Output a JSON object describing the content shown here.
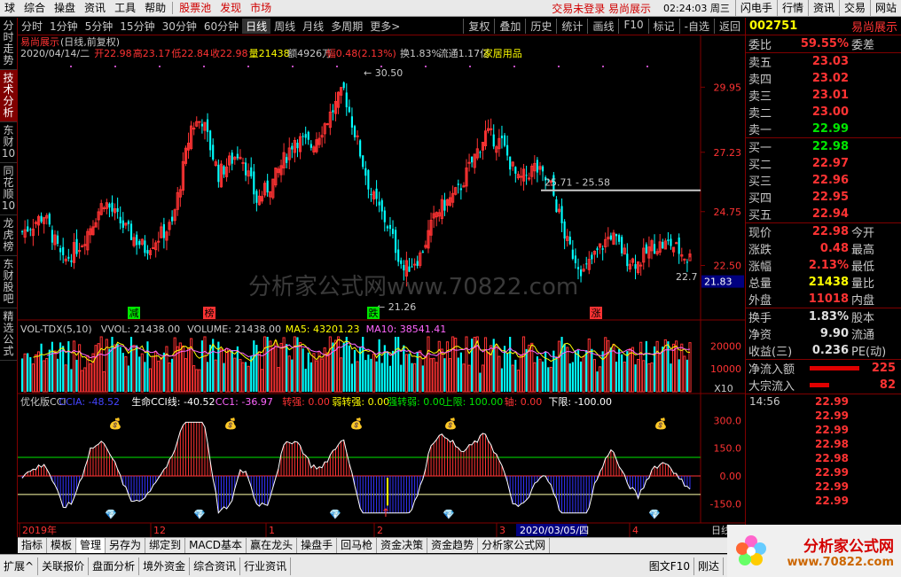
{
  "menu": {
    "items": [
      "球",
      "综合",
      "操盘",
      "资讯",
      "工具",
      "帮助"
    ],
    "red_items": [
      "股票池",
      "发现",
      "市场"
    ],
    "login": "交易未登录 易尚展示",
    "clock": "02:24:03 周三",
    "right": [
      "闪电手",
      "行情",
      "资讯",
      "交易",
      "网站"
    ]
  },
  "toolbar": {
    "periods": [
      "分时",
      "1分钟",
      "5分钟",
      "15分钟",
      "30分钟",
      "60分钟",
      "日线",
      "周线",
      "月线",
      "多周期",
      "更多>"
    ],
    "active": "日线",
    "right": [
      "复权",
      "叠加",
      "历史",
      "统计",
      "画线",
      "F10",
      "标记",
      "-自选",
      "返回"
    ]
  },
  "leftbar": [
    "分时走势",
    "技术分析",
    "东财10",
    "同花顺10",
    "龙虎榜",
    "东财股吧",
    "精选公式"
  ],
  "leftbar_active": "技术分析",
  "kline": {
    "title": "易尚展示",
    "mode": "(日线,前复权)",
    "date": "2020/04/14/二",
    "open_label": "开",
    "open": "22.98",
    "high_label": "高",
    "high": "23.17",
    "low_label": "低",
    "low": "22.84",
    "close_label": "收",
    "close": "22.98",
    "vol_label": "量",
    "vol": "21438",
    "amt_label": "额",
    "amt": "4926万",
    "chg_label": "幅",
    "chg": "0.48(2.13%)",
    "turn": "换1.83%",
    "float": "流通1.17亿",
    "industry": "家居用品",
    "y_ticks": [
      "29.95",
      "27.23",
      "24.75",
      "22.50"
    ],
    "cur_price": "21.83",
    "max_label": "30.50",
    "min_label": "21.26",
    "last_label": "22.7",
    "level": "25.71 - 25.58",
    "marks": [
      "减",
      "榜",
      "跌",
      "涨"
    ]
  },
  "vol": {
    "title": "VOL-TDX(5,10)",
    "vvol": "VVOL: 21438.00",
    "volume": "VOLUME: 21438.00",
    "ma5": "MA5: 43201.23",
    "ma10": "MA10: 38541.41",
    "y_ticks": [
      "20000",
      "10000"
    ],
    "unit": "X10"
  },
  "cci": {
    "title": "优化版CCI",
    "ccia": "CCIA: -48.52",
    "life": "生命CCI线: -40.52",
    "cc1": "CC1: -36.97",
    "zhuanqiang": "转强: 0.00",
    "ruozhuanqiang": "弱转强: 0.00",
    "qiangzhuanruo": "强转弱: 0.00",
    "upper": "上限: 100.00",
    "axis": "轴: 0.00",
    "lower": "下限: -100.00",
    "y_ticks": [
      "300.0",
      "150.0",
      "0.00",
      "-150.0"
    ]
  },
  "xaxis": {
    "labels": [
      "2019年",
      "12",
      "1",
      "2",
      "3",
      "4"
    ],
    "cursor_date": "2020/03/05/四",
    "period": "日线"
  },
  "quote": {
    "code": "002751",
    "name": "易尚展示",
    "weibi_label": "委比",
    "weibi": "59.55%",
    "weicha_label": "委差",
    "asks": [
      {
        "l": "卖五",
        "p": "23.03"
      },
      {
        "l": "卖四",
        "p": "23.02"
      },
      {
        "l": "卖三",
        "p": "23.01"
      },
      {
        "l": "卖二",
        "p": "23.00"
      },
      {
        "l": "卖一",
        "p": "22.99"
      }
    ],
    "bids": [
      {
        "l": "买一",
        "p": "22.98"
      },
      {
        "l": "买二",
        "p": "22.97"
      },
      {
        "l": "买三",
        "p": "22.96"
      },
      {
        "l": "买四",
        "p": "22.95"
      },
      {
        "l": "买五",
        "p": "22.94"
      }
    ],
    "stats": [
      {
        "l": "现价",
        "v": "22.98",
        "r": "今开",
        "c": "up"
      },
      {
        "l": "涨跌",
        "v": "0.48",
        "r": "最高",
        "c": "up"
      },
      {
        "l": "涨幅",
        "v": "2.13%",
        "r": "最低",
        "c": "up"
      },
      {
        "l": "总量",
        "v": "21438",
        "r": "量比",
        "c": "yl"
      },
      {
        "l": "外盘",
        "v": "11018",
        "r": "内盘",
        "c": "up"
      }
    ],
    "stats2": [
      {
        "l": "换手",
        "v": "1.83%",
        "r": "股本",
        "c": "wt"
      },
      {
        "l": "净资",
        "v": "9.90",
        "r": "流通",
        "c": "wt"
      },
      {
        "l": "收益(三)",
        "v": "0.236",
        "r": "PE(动)",
        "c": "wt"
      }
    ],
    "flow": [
      {
        "l": "净流入额",
        "v": "225"
      },
      {
        "l": "大宗流入",
        "v": "82"
      }
    ],
    "ticks": [
      {
        "t": "14:56",
        "v": "22.99"
      },
      {
        "t": "",
        "v": "22.99"
      },
      {
        "t": "",
        "v": "22.99"
      },
      {
        "t": "",
        "v": "22.98"
      },
      {
        "t": "",
        "v": "22.98"
      },
      {
        "t": "",
        "v": "22.99"
      },
      {
        "t": "",
        "v": "22.99"
      },
      {
        "t": "",
        "v": "22.99"
      }
    ]
  },
  "bottom_tabs": [
    "指标",
    "模板",
    "管理",
    "另存为",
    "绑定到",
    "MACD基本",
    "赢在龙头",
    "操盘手",
    "回马枪",
    "资金决策",
    "资金趋势",
    "分析家公式网"
  ],
  "bottom_active": "管理",
  "status": [
    "扩展^",
    "关联报价",
    "盘面分析",
    "境外资金",
    "综合资讯",
    "行业资讯"
  ],
  "status_right": [
    "图文F10",
    "刚达"
  ],
  "logo": {
    "name": "分析家公式网",
    "url": "www.70822.com"
  },
  "watermark": "分析家公式网www.70822.com",
  "colors": {
    "up": "#ff3333",
    "down": "#00ffff",
    "green": "#00e600",
    "yellow": "#ffff00",
    "panel_border": "#800000"
  }
}
